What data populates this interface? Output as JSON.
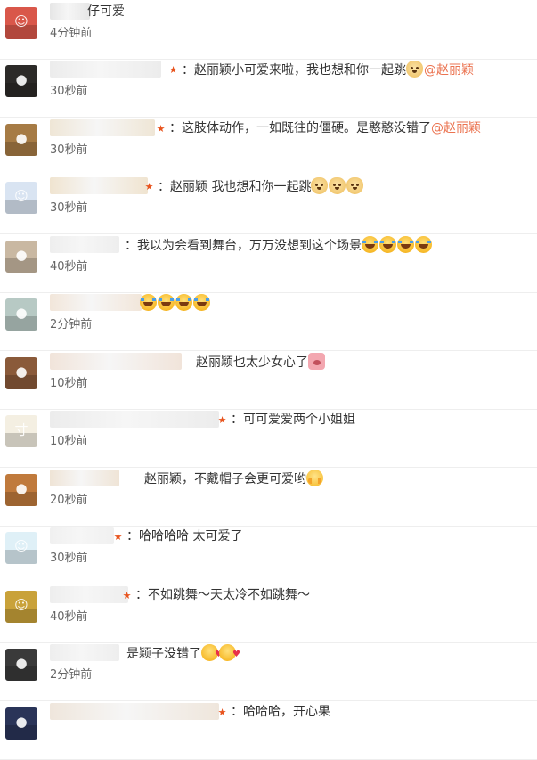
{
  "comments": [
    {
      "text": "仔可爱",
      "mention": "",
      "time": "4分钟前",
      "emojis": [],
      "avatar_color": "#d9574a",
      "avatar_icon": "cartoon-avatar",
      "name_color": "#e6e6e6",
      "badge": false
    },
    {
      "text": "：赵丽颖小可爱来啦，我也想和你一起跳",
      "mention": "@赵丽颖",
      "time": "30秒前",
      "emojis": [
        "doge"
      ],
      "avatar_color": "#2c2a28",
      "avatar_icon": "photo-avatar",
      "name_color": "#ececec",
      "badge": true
    },
    {
      "text": "：这肢体动作，一如既往的僵硬。是憨憨没错了",
      "mention": "@赵丽颖",
      "time": "30秒前",
      "emojis": [],
      "avatar_color": "#a67b45",
      "avatar_icon": "photo-avatar",
      "name_color": "#efe6d6",
      "badge": true
    },
    {
      "text": "：赵丽颖 我也想和你一起跳",
      "mention": "",
      "time": "30秒前",
      "emojis": [
        "doge",
        "doge",
        "doge"
      ],
      "avatar_color": "#d9e4f2",
      "avatar_icon": "cartoon-avatar",
      "name_color": "#f0e4d0",
      "badge": true
    },
    {
      "text": "：我以为会看到舞台，万万没想到这个场景",
      "mention": "",
      "time": "40秒前",
      "emojis": [
        "laugh",
        "laugh",
        "laugh",
        "laugh"
      ],
      "avatar_color": "#c9b8a2",
      "avatar_icon": "photo-avatar",
      "name_color": "#eeeeee",
      "badge": false
    },
    {
      "text": "",
      "mention": "",
      "time": "2分钟前",
      "emojis": [
        "laugh",
        "laugh",
        "laugh",
        "laugh"
      ],
      "avatar_color": "#b7c9c4",
      "avatar_icon": "photo-avatar",
      "name_color": "#f2e6da",
      "badge": false
    },
    {
      "text": "赵丽颖也太少女心了",
      "mention": "",
      "time": "10秒前",
      "emojis": [
        "pig"
      ],
      "avatar_color": "#8a5a3a",
      "avatar_icon": "photo-avatar",
      "name_color": "#f1e4da",
      "badge": false
    },
    {
      "text": "：可可爱爱两个小姐姐",
      "mention": "",
      "time": "10秒前",
      "emojis": [],
      "avatar_color": "#f4efe2",
      "avatar_icon": "calligraphy-avatar",
      "name_color": "#ececec",
      "badge": true
    },
    {
      "text": "赵丽颖，不戴帽子会更可爱哟",
      "mention": "",
      "time": "20秒前",
      "emojis": [
        "shy"
      ],
      "avatar_color": "#c07a3c",
      "avatar_icon": "photo-avatar",
      "name_color": "#efe4d6",
      "badge": false
    },
    {
      "text": "：哈哈哈哈 太可爱了",
      "mention": "",
      "time": "30秒前",
      "emojis": [],
      "avatar_color": "#dff0f7",
      "avatar_icon": "cartoon-avatar",
      "name_color": "#f0f0f0",
      "badge": true
    },
    {
      "text": "：不如跳舞～天太冷不如跳舞～",
      "mention": "",
      "time": "40秒前",
      "emojis": [],
      "avatar_color": "#c9a23a",
      "avatar_icon": "cartoon-avatar",
      "name_color": "#eeeeee",
      "badge": true
    },
    {
      "text": "是颖子没错了",
      "mention": "",
      "time": "2分钟前",
      "emojis": [
        "kiss",
        "kiss"
      ],
      "avatar_color": "#3a3a3a",
      "avatar_icon": "photo-avatar",
      "name_color": "#eeeeee",
      "badge": false
    },
    {
      "text": "：哈哈哈，开心果",
      "mention": "",
      "time": "",
      "emojis": [],
      "avatar_color": "#2a3458",
      "avatar_icon": "photo-avatar",
      "name_color": "#efe6dc",
      "badge": true
    }
  ]
}
